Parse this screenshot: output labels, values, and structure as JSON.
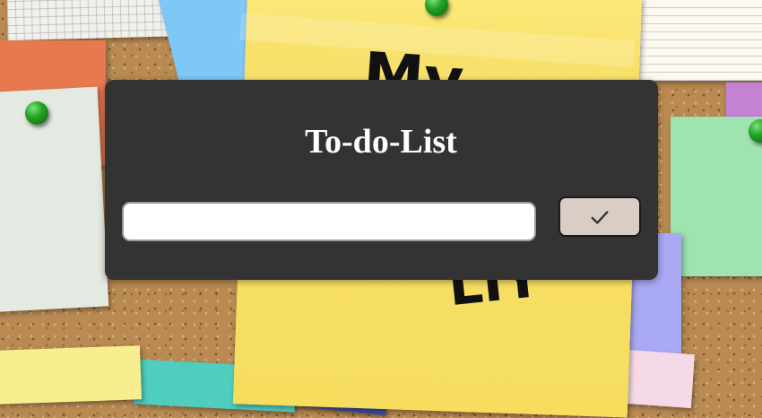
{
  "app": {
    "title": "To-do-List"
  },
  "input": {
    "value": "",
    "placeholder": ""
  },
  "submit": {
    "icon": "check-icon"
  },
  "board": {
    "note_scribble_top": "My",
    "note_scribble_bottom": "LIY"
  },
  "colors": {
    "panel_bg": "#333333",
    "button_bg": "#d9cdc5",
    "title_text": "#ffffff"
  }
}
